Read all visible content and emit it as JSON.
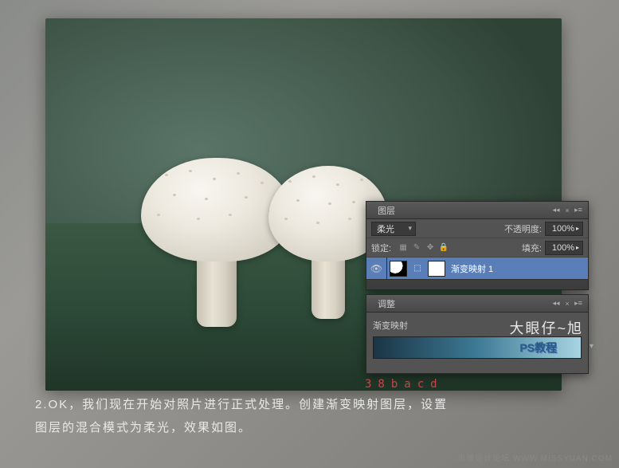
{
  "panels": {
    "layers": {
      "tab": "图层",
      "blendMode": "柔光",
      "opacityLabel": "不透明度:",
      "opacityValue": "100%",
      "lockLabel": "锁定:",
      "fillLabel": "填充:",
      "fillValue": "100%",
      "layerName": "渐变映射 1"
    },
    "adjust": {
      "tab": "调整",
      "title": "渐变映射",
      "overlay": "大眼仔~旭",
      "psText": "PS教程",
      "code": "38bacd"
    }
  },
  "caption": {
    "line1": "2.OK，我们现在开始对照片进行正式处理。创建渐变映射图层，设置",
    "line2": "图层的混合模式为柔光，效果如图。"
  },
  "watermark": "思缘设计论坛 WWW.MISSYUAN.COM"
}
